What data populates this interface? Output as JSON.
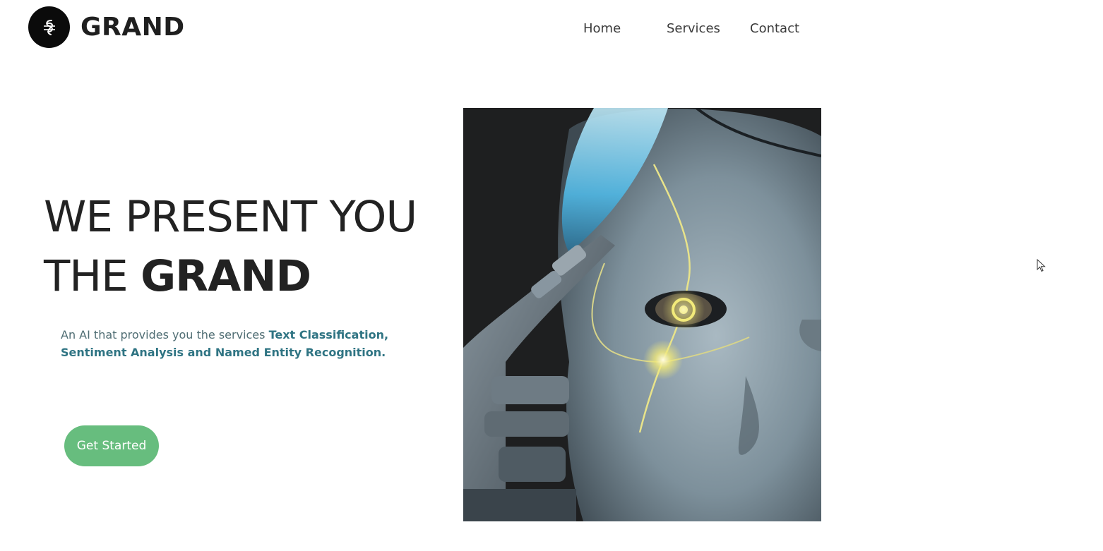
{
  "header": {
    "brand": "GRAND",
    "nav": [
      {
        "label": "Home"
      },
      {
        "label": "Services"
      },
      {
        "label": "Contact"
      }
    ]
  },
  "hero": {
    "headline_line1": "WE PRESENT YOU",
    "headline_line2_prefix": "THE",
    "headline_line2_brand": "GRAND",
    "description_prefix": "An AI that provides you the services",
    "description_services": "Text Classification, Sentiment Analysis and Named Entity Recognition.",
    "cta_label": "Get Started",
    "image": "robot-face-illustration"
  },
  "colors": {
    "cta_bg": "#67bd7e",
    "services_text": "#2f7483",
    "logo_bg": "#0b0b0b"
  },
  "icons": {
    "logo": "logo-icon",
    "cursor": "mouse-pointer-icon"
  }
}
